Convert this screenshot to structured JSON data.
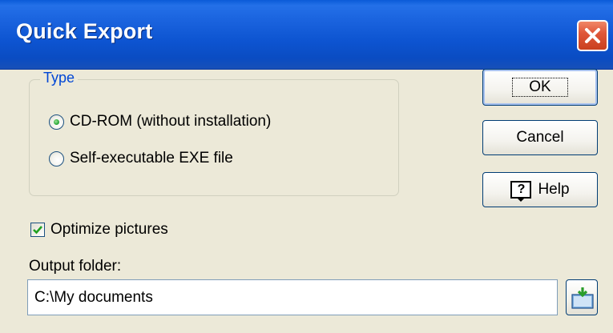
{
  "window": {
    "title": "Quick Export"
  },
  "type_group": {
    "label": "Type",
    "options": [
      {
        "label": "CD-ROM (without installation)",
        "checked": true
      },
      {
        "label": "Self-executable EXE file",
        "checked": false
      }
    ]
  },
  "optimize": {
    "label": "Optimize pictures",
    "checked": true
  },
  "output": {
    "label": "Output folder:",
    "value": "C:\\My documents"
  },
  "buttons": {
    "ok": "OK",
    "cancel": "Cancel",
    "help": "Help",
    "help_icon_glyph": "?"
  },
  "icons": {
    "close": "close-icon",
    "help": "help-icon",
    "browse": "folder-browse-icon"
  },
  "colors": {
    "titlebar": "#0a54d1",
    "close": "#e0583a",
    "group_label": "#0046d5",
    "radio_dot": "#2bab3a",
    "check": "#21a121"
  }
}
